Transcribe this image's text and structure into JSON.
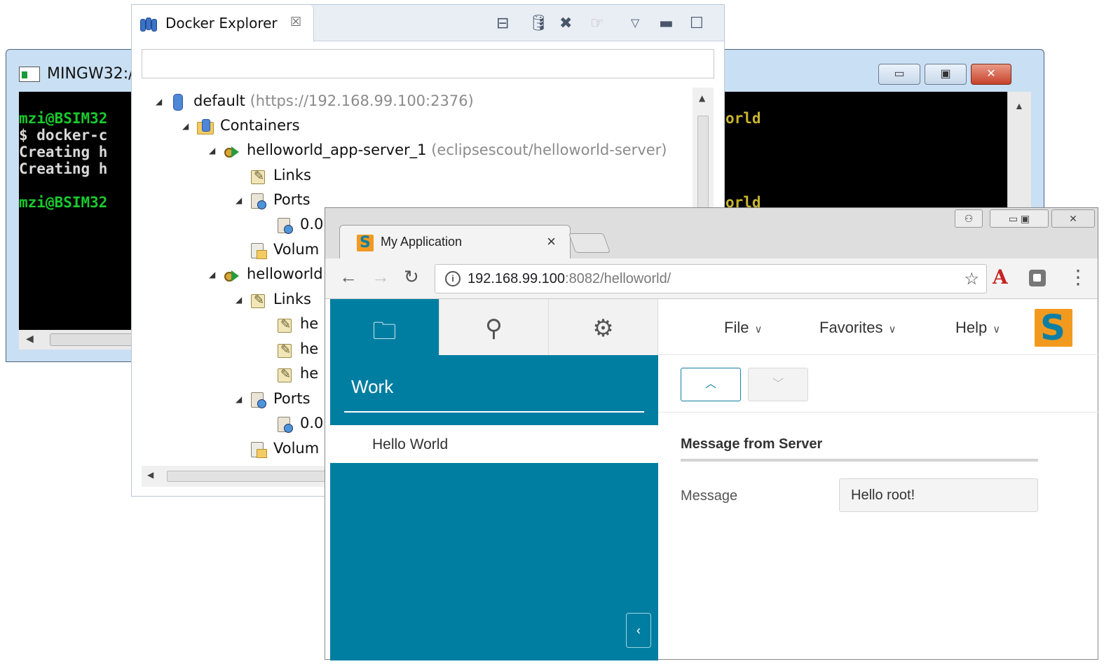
{
  "terminal": {
    "title": "MINGW32:/",
    "lines": [
      {
        "text": "mzi@BSIM32",
        "color": "g"
      },
      {
        "text": "$ docker-c",
        "color": "w"
      },
      {
        "text": "Creating h",
        "color": "w"
      },
      {
        "text": "Creating h",
        "color": "w"
      },
      {
        "text": "",
        "color": "w"
      },
      {
        "text": "mzi@BSIM32",
        "color": "g"
      }
    ],
    "right_lines": [
      "orld",
      "orld"
    ]
  },
  "docker": {
    "tab_title": "Docker Explorer",
    "search_value": "",
    "tree": [
      {
        "label": "default",
        "sub": "(https://192.168.99.100:2376)",
        "icon": "db",
        "expanded": true
      },
      {
        "label": "Containers",
        "sub": "",
        "icon": "folder",
        "expanded": true
      },
      {
        "label": "helloworld_app-server_1",
        "sub": "(eclipsescout/helloworld-server)",
        "icon": "cont",
        "expanded": true
      },
      {
        "label": "Links",
        "sub": "",
        "icon": "link",
        "expanded": false
      },
      {
        "label": "Ports",
        "sub": "",
        "icon": "port",
        "expanded": true
      },
      {
        "label": "0.0",
        "sub": "",
        "icon": "port",
        "expanded": false
      },
      {
        "label": "Volum",
        "sub": "",
        "icon": "vol",
        "expanded": false
      },
      {
        "label": "helloworld",
        "sub": "",
        "icon": "cont",
        "expanded": true
      },
      {
        "label": "Links",
        "sub": "",
        "icon": "link",
        "expanded": true
      },
      {
        "label": "he",
        "sub": "",
        "icon": "link",
        "expanded": false
      },
      {
        "label": "he",
        "sub": "",
        "icon": "link",
        "expanded": false
      },
      {
        "label": "he",
        "sub": "",
        "icon": "link",
        "expanded": false
      },
      {
        "label": "Ports",
        "sub": "",
        "icon": "port",
        "expanded": true
      },
      {
        "label": "0.0",
        "sub": "",
        "icon": "port",
        "expanded": false
      },
      {
        "label": "Volum",
        "sub": "",
        "icon": "vol",
        "expanded": false
      }
    ]
  },
  "browser": {
    "tab_title": "My Application",
    "url_host": "192.168.99.100",
    "url_path": ":8082/helloworld/",
    "ext_label": "A",
    "app": {
      "outline_title": "Work",
      "node": "Hello World",
      "menus": [
        "File",
        "Favorites",
        "Help"
      ],
      "group_title": "Message from Server",
      "field_label": "Message",
      "field_value": "Hello root!"
    }
  },
  "colors": {
    "scout_blue": "#007ea1",
    "scout_orange": "#f29a1f",
    "terminal_green": "#19c92e"
  }
}
